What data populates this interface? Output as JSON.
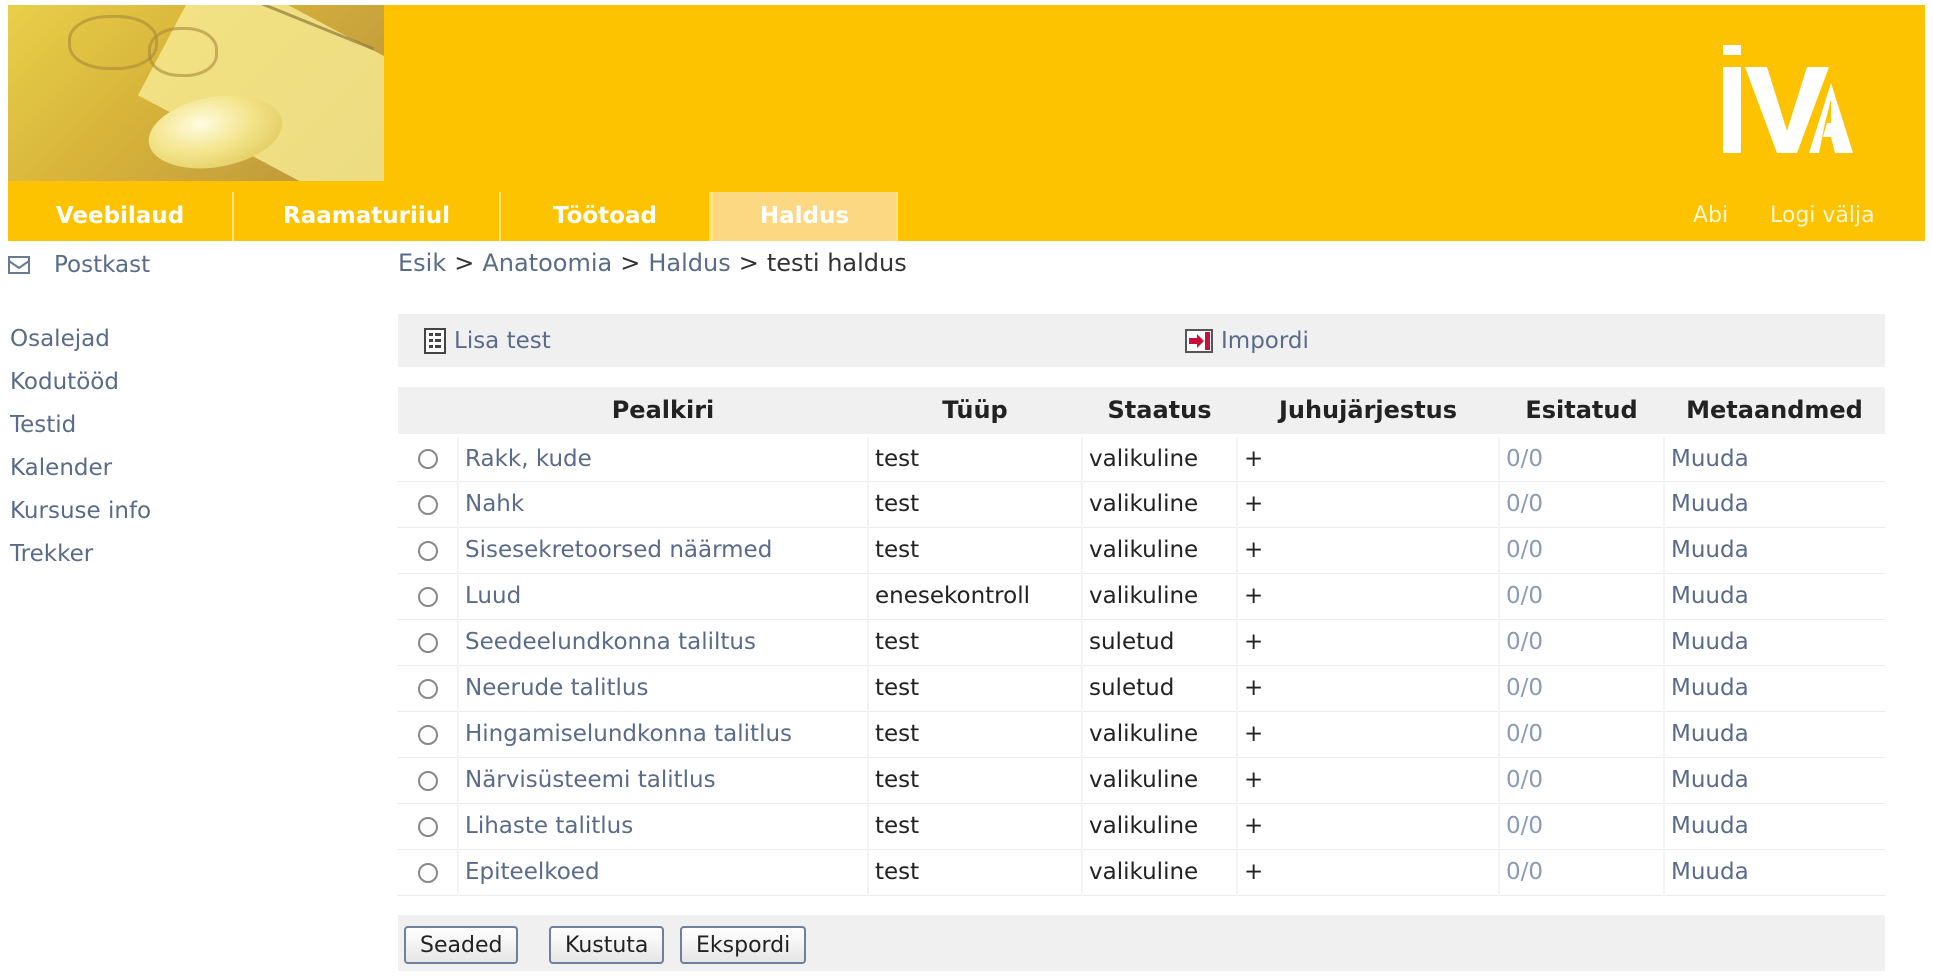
{
  "nav": {
    "tabs": [
      "Veebilaud",
      "Raamaturiiul",
      "Töötoad",
      "Haldus"
    ],
    "active_tab": "Haldus",
    "help": "Abi",
    "logout": "Logi välja"
  },
  "sidebar": {
    "postkast": "Postkast",
    "items": [
      "Osalejad",
      "Kodutööd",
      "Testid",
      "Kalender",
      "Kursuse info",
      "Trekker"
    ]
  },
  "breadcrumb": {
    "items": [
      "Esik",
      "Anatoomia",
      "Haldus"
    ],
    "separator": ">",
    "current": "testi haldus"
  },
  "actions": {
    "add_test": "Lisa test",
    "import": "Impordi"
  },
  "table": {
    "headers": [
      "Pealkiri",
      "Tüüp",
      "Staatus",
      "Juhujärjestus",
      "Esitatud",
      "Metaandmed"
    ],
    "rows": [
      {
        "title": "Rakk, kude",
        "type": "test",
        "status": "valikuline",
        "random": "+",
        "submitted": "0/0",
        "meta": "Muuda"
      },
      {
        "title": "Nahk",
        "type": "test",
        "status": "valikuline",
        "random": "+",
        "submitted": "0/0",
        "meta": "Muuda"
      },
      {
        "title": "Sisesekretoorsed näärmed",
        "type": "test",
        "status": "valikuline",
        "random": "+",
        "submitted": "0/0",
        "meta": "Muuda"
      },
      {
        "title": "Luud",
        "type": "enesekontroll",
        "status": "valikuline",
        "random": "+",
        "submitted": "0/0",
        "meta": "Muuda"
      },
      {
        "title": "Seedeelundkonna taliltus",
        "type": "test",
        "status": "suletud",
        "random": "+",
        "submitted": "0/0",
        "meta": "Muuda"
      },
      {
        "title": "Neerude talitlus",
        "type": "test",
        "status": "suletud",
        "random": "+",
        "submitted": "0/0",
        "meta": "Muuda"
      },
      {
        "title": "Hingamiselundkonna talitlus",
        "type": "test",
        "status": "valikuline",
        "random": "+",
        "submitted": "0/0",
        "meta": "Muuda"
      },
      {
        "title": "Närvisüsteemi talitlus",
        "type": "test",
        "status": "valikuline",
        "random": "+",
        "submitted": "0/0",
        "meta": "Muuda"
      },
      {
        "title": "Lihaste talitlus",
        "type": "test",
        "status": "valikuline",
        "random": "+",
        "submitted": "0/0",
        "meta": "Muuda"
      },
      {
        "title": "Epiteelkoed",
        "type": "test",
        "status": "valikuline",
        "random": "+",
        "submitted": "0/0",
        "meta": "Muuda"
      }
    ]
  },
  "buttons": {
    "settings": "Seaded",
    "delete": "Kustuta",
    "export": "Ekspordi"
  },
  "colors": {
    "brand_yellow": "#fec300",
    "link": "#5a6b8a",
    "panel_gray": "#f0f0f0"
  },
  "icons": {
    "logo": "iva-logo",
    "postkast": "envelope-icon",
    "add_test": "test-doc-icon",
    "import": "import-arrow-icon"
  }
}
